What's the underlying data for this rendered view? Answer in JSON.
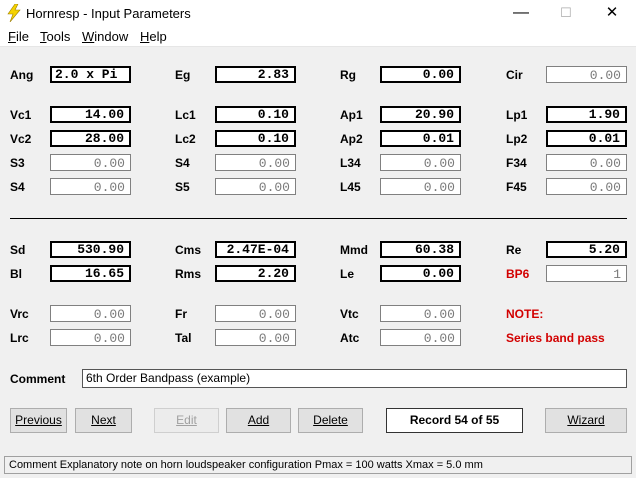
{
  "window": {
    "title": "Hornresp - Input Parameters",
    "minimize": "—",
    "maximize": "☐",
    "close": "✕"
  },
  "menu": [
    "File",
    "Tools",
    "Window",
    "Help"
  ],
  "fields": {
    "Ang": "2.0 x Pi",
    "Eg": "2.83",
    "Rg": "0.00",
    "Cir": "0.00",
    "Vc1": "14.00",
    "Lc1": "0.10",
    "Ap1": "20.90",
    "Lp1": "1.90",
    "Vc2": "28.00",
    "Lc2": "0.10",
    "Ap2": "0.01",
    "Lp2": "0.01",
    "S3": "0.00",
    "S4a": "0.00",
    "L34": "0.00",
    "F34": "0.00",
    "S4b": "0.00",
    "S5": "0.00",
    "L45": "0.00",
    "F45": "0.00",
    "Sd": "530.90",
    "Cms": "2.47E-04",
    "Mmd": "60.38",
    "Re": "5.20",
    "Bl": "16.65",
    "Rms": "2.20",
    "Le": "0.00",
    "BP6": "1",
    "Vrc": "0.00",
    "Fr": "0.00",
    "Vtc": "0.00",
    "Lrc": "0.00",
    "Tal": "0.00",
    "Atc": "0.00"
  },
  "labels": {
    "Ang": "Ang",
    "Eg": "Eg",
    "Rg": "Rg",
    "Cir": "Cir",
    "Vc1": "Vc1",
    "Lc1": "Lc1",
    "Ap1": "Ap1",
    "Lp1": "Lp1",
    "Vc2": "Vc2",
    "Lc2": "Lc2",
    "Ap2": "Ap2",
    "Lp2": "Lp2",
    "S3": "S3",
    "S4a": "S4",
    "L34": "L34",
    "F34": "F34",
    "S4b": "S4",
    "S5": "S5",
    "L45": "L45",
    "F45": "F45",
    "Sd": "Sd",
    "Cms": "Cms",
    "Mmd": "Mmd",
    "Re": "Re",
    "Bl": "Bl",
    "Rms": "Rms",
    "Le": "Le",
    "BP6": "BP6",
    "Vrc": "Vrc",
    "Fr": "Fr",
    "Vtc": "Vtc",
    "Lrc": "Lrc",
    "Tal": "Tal",
    "Atc": "Atc"
  },
  "note": {
    "label": "NOTE:",
    "text": "Series band pass"
  },
  "comment": {
    "label": "Comment",
    "value": "6th Order Bandpass (example)"
  },
  "buttons": {
    "previous": "Previous",
    "next": "Next",
    "edit": "Edit",
    "add": "Add",
    "delete": "Delete",
    "wizard": "Wizard"
  },
  "record": "Record 54 of 55",
  "status": "Comment   Explanatory note on horn loudspeaker configuration   Pmax = 100 watts   Xmax = 5.0 mm",
  "colors": {
    "accent_red": "#d20000",
    "window_bg": "#f0f0f0"
  }
}
